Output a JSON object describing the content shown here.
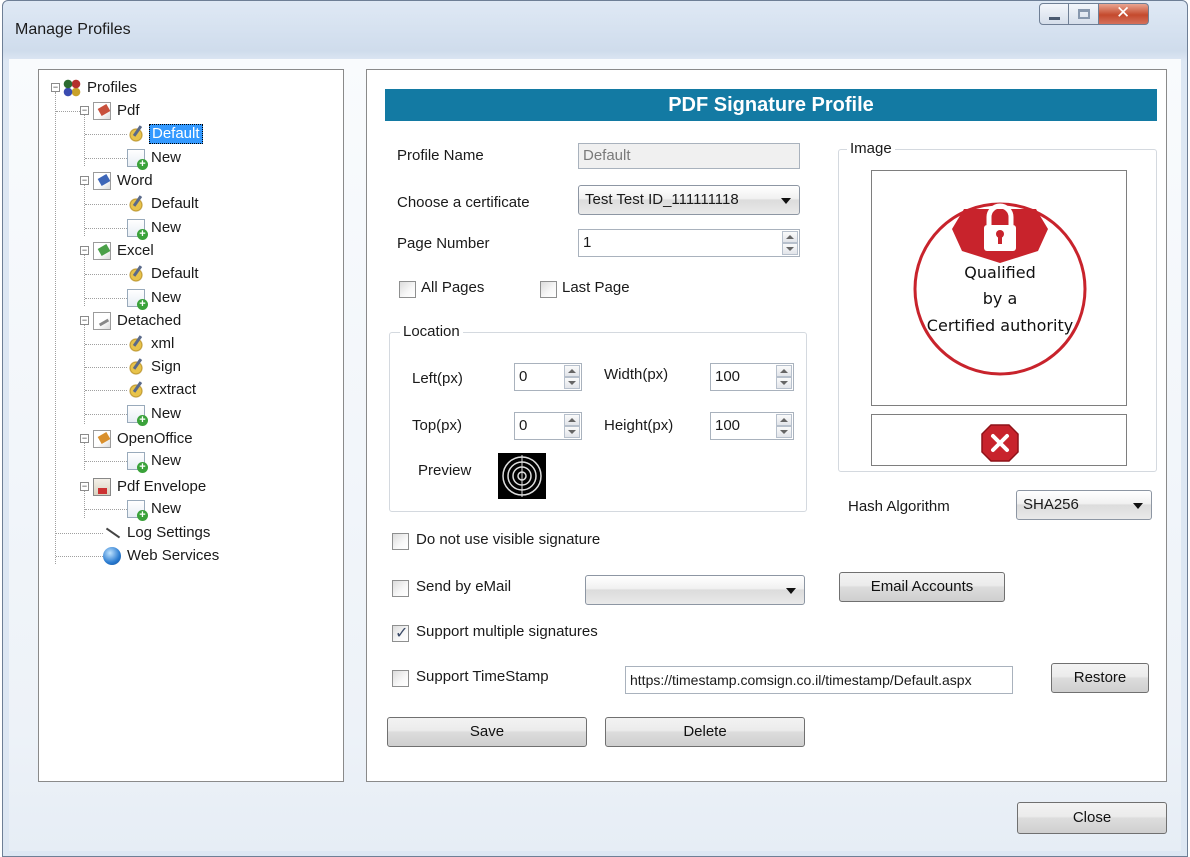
{
  "window": {
    "title": "Manage Profiles"
  },
  "tree": {
    "root": "Profiles",
    "items": [
      {
        "label": "Pdf",
        "icon": "pdf-document-icon"
      },
      {
        "label": "Default",
        "icon": "pen-seal-icon",
        "selected": true
      },
      {
        "label": "New",
        "icon": "new-profile-icon"
      },
      {
        "label": "Word",
        "icon": "word-document-icon"
      },
      {
        "label": "Default",
        "icon": "pen-seal-icon"
      },
      {
        "label": "New",
        "icon": "new-profile-icon"
      },
      {
        "label": "Excel",
        "icon": "excel-document-icon"
      },
      {
        "label": "Default",
        "icon": "pen-seal-icon"
      },
      {
        "label": "New",
        "icon": "new-profile-icon"
      },
      {
        "label": "Detached",
        "icon": "detached-document-icon"
      },
      {
        "label": "xml",
        "icon": "pen-seal-icon"
      },
      {
        "label": "Sign",
        "icon": "pen-seal-icon"
      },
      {
        "label": "extract",
        "icon": "pen-seal-icon"
      },
      {
        "label": "New",
        "icon": "new-profile-icon"
      },
      {
        "label": "OpenOffice",
        "icon": "openoffice-document-icon"
      },
      {
        "label": "New",
        "icon": "new-profile-icon"
      },
      {
        "label": "Pdf Envelope",
        "icon": "pdf-envelope-icon"
      },
      {
        "label": "New",
        "icon": "new-profile-icon"
      },
      {
        "label": "Log Settings",
        "icon": "log-settings-icon"
      },
      {
        "label": "Web Services",
        "icon": "globe-icon"
      }
    ]
  },
  "panel": {
    "banner": "PDF Signature Profile",
    "profile_name_label": "Profile Name",
    "profile_name_value": "Default",
    "certificate_label": "Choose a certificate",
    "certificate_value": "Test Test ID_111111118",
    "page_number_label": "Page Number",
    "page_number_value": "1",
    "all_pages_label": "All Pages",
    "all_pages_checked": false,
    "last_page_label": "Last Page",
    "last_page_checked": false,
    "location": {
      "title": "Location",
      "left_label": "Left(px)",
      "left_value": "0",
      "width_label": "Width(px)",
      "width_value": "100",
      "top_label": "Top(px)",
      "top_value": "0",
      "height_label": "Height(px)",
      "height_value": "100",
      "preview_label": "Preview"
    },
    "image": {
      "title": "Image",
      "stamp_line1": "Qualified",
      "stamp_line2": "by a",
      "stamp_line3": "Certified authority"
    },
    "hash_label": "Hash Algorithm",
    "hash_value": "SHA256",
    "no_visible_sig_label": "Do not use visible signature",
    "no_visible_sig_checked": false,
    "send_email_label": "Send by eMail",
    "send_email_checked": false,
    "email_value": "",
    "email_accounts_label": "Email Accounts",
    "multi_sig_label": "Support multiple signatures",
    "multi_sig_checked": true,
    "timestamp_label": "Support TimeStamp",
    "timestamp_checked": false,
    "timestamp_url": "https://timestamp.comsign.co.il/timestamp/Default.aspx",
    "restore_label": "Restore",
    "save_label": "Save",
    "delete_label": "Delete"
  },
  "footer": {
    "close_label": "Close"
  },
  "colors": {
    "banner": "#137aa3",
    "selection": "#3399ff",
    "stamp_red": "#c8232c"
  }
}
